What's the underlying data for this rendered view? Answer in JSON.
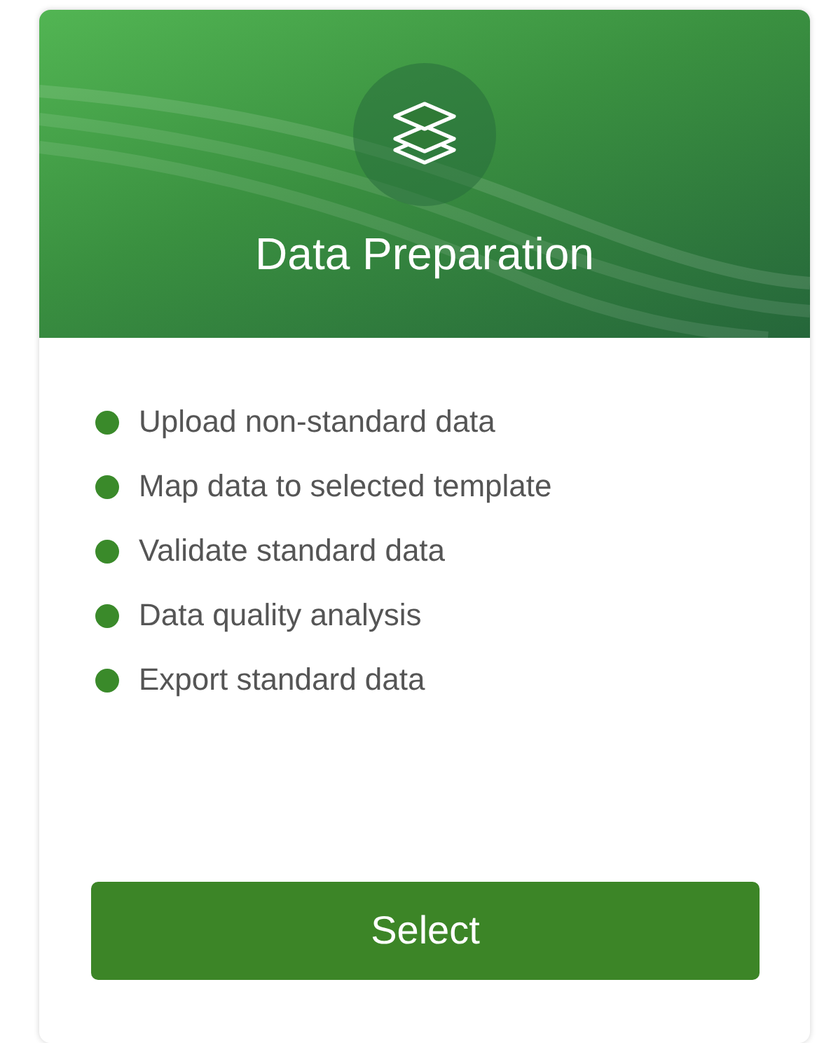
{
  "card": {
    "title": "Data Preparation",
    "features": [
      {
        "label": "Upload non-standard data",
        "color": "#3a8a2a"
      },
      {
        "label": "Map data to selected template",
        "color": "#3a8a2a"
      },
      {
        "label": "Validate standard data",
        "color": "#3a8a2a"
      },
      {
        "label": "Data quality analysis",
        "color": "#3a8a2a"
      },
      {
        "label": "Export standard data",
        "color": "#3a8a2a"
      }
    ],
    "button": "Select"
  }
}
